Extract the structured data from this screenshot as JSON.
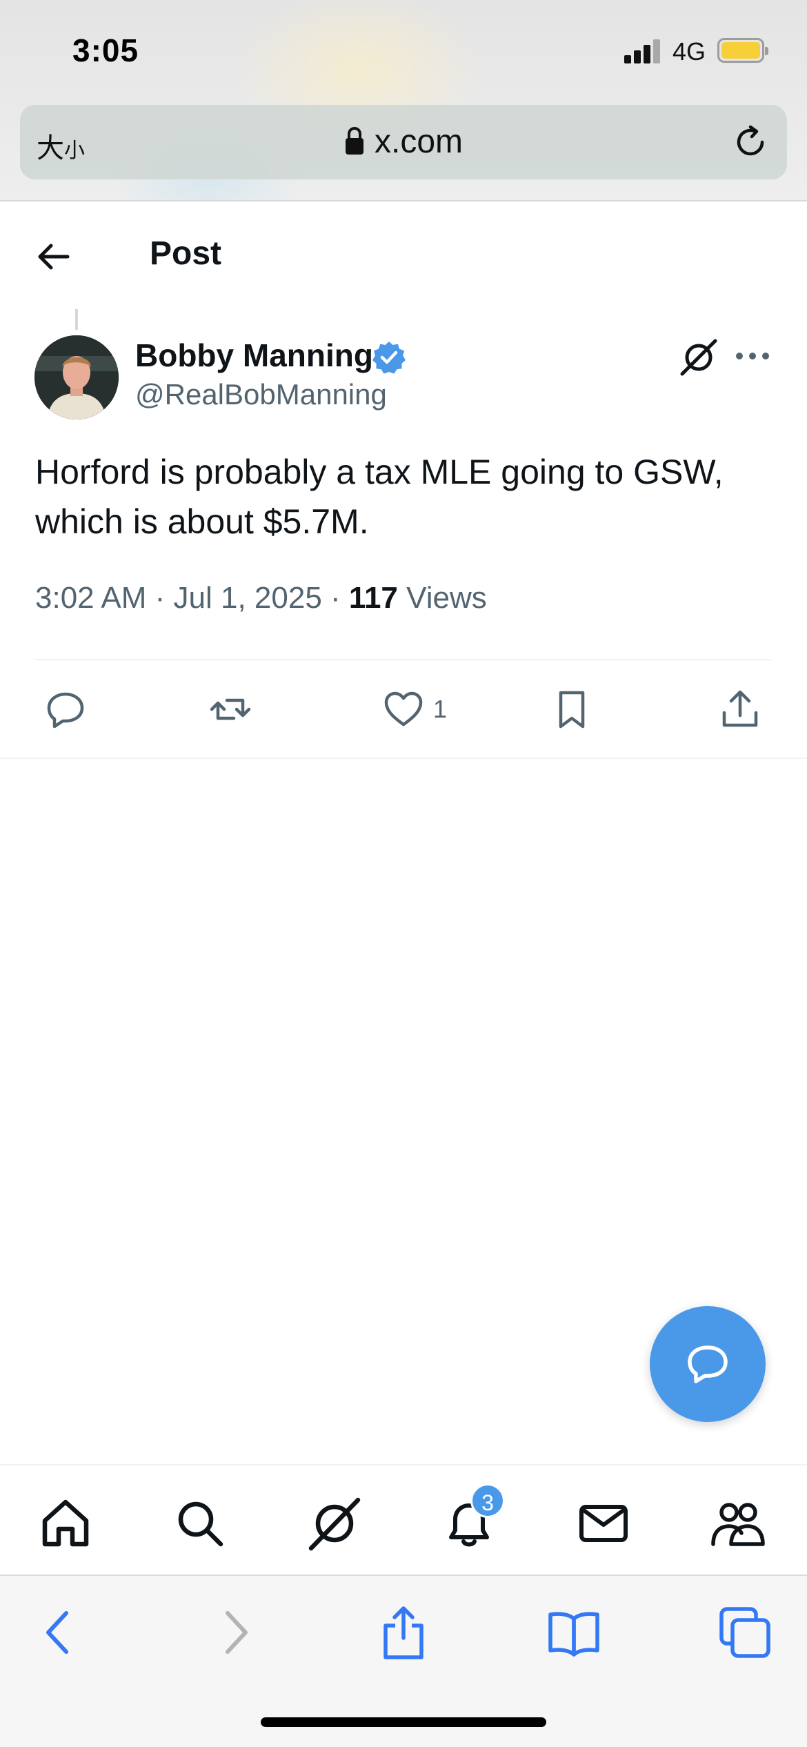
{
  "status_bar": {
    "time": "3:05",
    "network": "4G",
    "battery_color": "#f6cf39"
  },
  "browser": {
    "text_size_label": "大",
    "text_size_label_small": "小",
    "url": "x.com",
    "accent_color": "#3478f6"
  },
  "header": {
    "title": "Post"
  },
  "post": {
    "display_name": "Bobby Manning",
    "handle": "@RealBobManning",
    "verified": true,
    "text": "Horford is probably a tax MLE going to GSW, which is about $5.7M.",
    "timestamp": "3:02 AM · Jul 1, 2025 ·",
    "views_count": "117",
    "views_label": "Views",
    "like_count": "1"
  },
  "actions": {
    "icons": [
      "reply-icon",
      "repost-icon",
      "like-icon",
      "bookmark-icon",
      "share-icon"
    ]
  },
  "tabbar": {
    "icons": [
      "home-icon",
      "search-icon",
      "grok-icon",
      "notifications-icon",
      "messages-icon",
      "communities-icon"
    ],
    "notification_badge": "3"
  },
  "colors": {
    "brand_blue": "#4a99e9",
    "text_primary": "#0f1419",
    "text_secondary": "#536471"
  }
}
